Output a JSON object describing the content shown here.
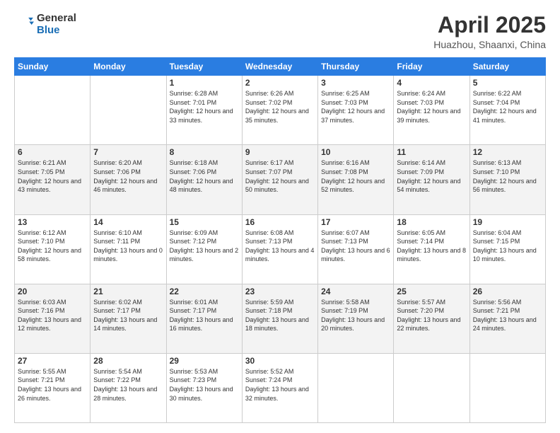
{
  "logo": {
    "line1": "General",
    "line2": "Blue"
  },
  "title": "April 2025",
  "location": "Huazhou, Shaanxi, China",
  "days_of_week": [
    "Sunday",
    "Monday",
    "Tuesday",
    "Wednesday",
    "Thursday",
    "Friday",
    "Saturday"
  ],
  "weeks": [
    [
      {
        "day": "",
        "text": ""
      },
      {
        "day": "",
        "text": ""
      },
      {
        "day": "1",
        "text": "Sunrise: 6:28 AM\nSunset: 7:01 PM\nDaylight: 12 hours and 33 minutes."
      },
      {
        "day": "2",
        "text": "Sunrise: 6:26 AM\nSunset: 7:02 PM\nDaylight: 12 hours and 35 minutes."
      },
      {
        "day": "3",
        "text": "Sunrise: 6:25 AM\nSunset: 7:03 PM\nDaylight: 12 hours and 37 minutes."
      },
      {
        "day": "4",
        "text": "Sunrise: 6:24 AM\nSunset: 7:03 PM\nDaylight: 12 hours and 39 minutes."
      },
      {
        "day": "5",
        "text": "Sunrise: 6:22 AM\nSunset: 7:04 PM\nDaylight: 12 hours and 41 minutes."
      }
    ],
    [
      {
        "day": "6",
        "text": "Sunrise: 6:21 AM\nSunset: 7:05 PM\nDaylight: 12 hours and 43 minutes."
      },
      {
        "day": "7",
        "text": "Sunrise: 6:20 AM\nSunset: 7:06 PM\nDaylight: 12 hours and 46 minutes."
      },
      {
        "day": "8",
        "text": "Sunrise: 6:18 AM\nSunset: 7:06 PM\nDaylight: 12 hours and 48 minutes."
      },
      {
        "day": "9",
        "text": "Sunrise: 6:17 AM\nSunset: 7:07 PM\nDaylight: 12 hours and 50 minutes."
      },
      {
        "day": "10",
        "text": "Sunrise: 6:16 AM\nSunset: 7:08 PM\nDaylight: 12 hours and 52 minutes."
      },
      {
        "day": "11",
        "text": "Sunrise: 6:14 AM\nSunset: 7:09 PM\nDaylight: 12 hours and 54 minutes."
      },
      {
        "day": "12",
        "text": "Sunrise: 6:13 AM\nSunset: 7:10 PM\nDaylight: 12 hours and 56 minutes."
      }
    ],
    [
      {
        "day": "13",
        "text": "Sunrise: 6:12 AM\nSunset: 7:10 PM\nDaylight: 12 hours and 58 minutes."
      },
      {
        "day": "14",
        "text": "Sunrise: 6:10 AM\nSunset: 7:11 PM\nDaylight: 13 hours and 0 minutes."
      },
      {
        "day": "15",
        "text": "Sunrise: 6:09 AM\nSunset: 7:12 PM\nDaylight: 13 hours and 2 minutes."
      },
      {
        "day": "16",
        "text": "Sunrise: 6:08 AM\nSunset: 7:13 PM\nDaylight: 13 hours and 4 minutes."
      },
      {
        "day": "17",
        "text": "Sunrise: 6:07 AM\nSunset: 7:13 PM\nDaylight: 13 hours and 6 minutes."
      },
      {
        "day": "18",
        "text": "Sunrise: 6:05 AM\nSunset: 7:14 PM\nDaylight: 13 hours and 8 minutes."
      },
      {
        "day": "19",
        "text": "Sunrise: 6:04 AM\nSunset: 7:15 PM\nDaylight: 13 hours and 10 minutes."
      }
    ],
    [
      {
        "day": "20",
        "text": "Sunrise: 6:03 AM\nSunset: 7:16 PM\nDaylight: 13 hours and 12 minutes."
      },
      {
        "day": "21",
        "text": "Sunrise: 6:02 AM\nSunset: 7:17 PM\nDaylight: 13 hours and 14 minutes."
      },
      {
        "day": "22",
        "text": "Sunrise: 6:01 AM\nSunset: 7:17 PM\nDaylight: 13 hours and 16 minutes."
      },
      {
        "day": "23",
        "text": "Sunrise: 5:59 AM\nSunset: 7:18 PM\nDaylight: 13 hours and 18 minutes."
      },
      {
        "day": "24",
        "text": "Sunrise: 5:58 AM\nSunset: 7:19 PM\nDaylight: 13 hours and 20 minutes."
      },
      {
        "day": "25",
        "text": "Sunrise: 5:57 AM\nSunset: 7:20 PM\nDaylight: 13 hours and 22 minutes."
      },
      {
        "day": "26",
        "text": "Sunrise: 5:56 AM\nSunset: 7:21 PM\nDaylight: 13 hours and 24 minutes."
      }
    ],
    [
      {
        "day": "27",
        "text": "Sunrise: 5:55 AM\nSunset: 7:21 PM\nDaylight: 13 hours and 26 minutes."
      },
      {
        "day": "28",
        "text": "Sunrise: 5:54 AM\nSunset: 7:22 PM\nDaylight: 13 hours and 28 minutes."
      },
      {
        "day": "29",
        "text": "Sunrise: 5:53 AM\nSunset: 7:23 PM\nDaylight: 13 hours and 30 minutes."
      },
      {
        "day": "30",
        "text": "Sunrise: 5:52 AM\nSunset: 7:24 PM\nDaylight: 13 hours and 32 minutes."
      },
      {
        "day": "",
        "text": ""
      },
      {
        "day": "",
        "text": ""
      },
      {
        "day": "",
        "text": ""
      }
    ]
  ]
}
